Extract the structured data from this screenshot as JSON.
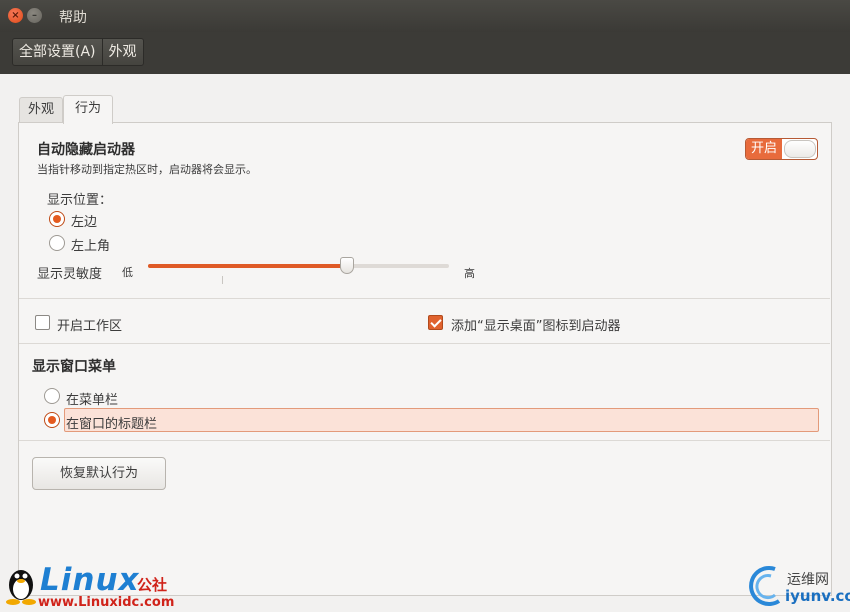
{
  "window": {
    "title": "帮助"
  },
  "menubar": {
    "items": [
      "全部设置(A)",
      "外观"
    ]
  },
  "tabs": [
    {
      "label": "外观",
      "active": false
    },
    {
      "label": "行为",
      "active": true
    }
  ],
  "launcher": {
    "title": "自动隐藏启动器",
    "description": "当指针移动到指定热区时，启动器将会显示。",
    "toggle_label": "开启",
    "toggle_on": true,
    "position_label": "显示位置：",
    "positions": [
      {
        "label": "左边",
        "selected": true
      },
      {
        "label": "左上角",
        "selected": false
      }
    ],
    "sensitivity_label": "显示灵敏度",
    "sensitivity_low": "低",
    "sensitivity_high": "高",
    "sensitivity_value": 0.66
  },
  "workspaces": {
    "label": "开启工作区",
    "checked": false
  },
  "show_desktop": {
    "label": "添加“显示桌面”图标到启动器",
    "checked": true
  },
  "window_menu": {
    "title": "显示窗口菜单",
    "options": [
      {
        "label": "在菜单栏",
        "selected": false
      },
      {
        "label": "在窗口的标题栏",
        "selected": true
      }
    ]
  },
  "reset_button": {
    "label": "恢复默认行为"
  },
  "watermarks": {
    "left_brand": "Linux",
    "left_brand_suffix": "公社",
    "left_url": "www.Linuxidc.com",
    "right_brand_cn": "运维网",
    "right_brand_en": "iyunv.com"
  },
  "colors": {
    "accent": "#e0622e",
    "titlebar": "#3c3b37",
    "highlight": "#fbe2d8"
  }
}
